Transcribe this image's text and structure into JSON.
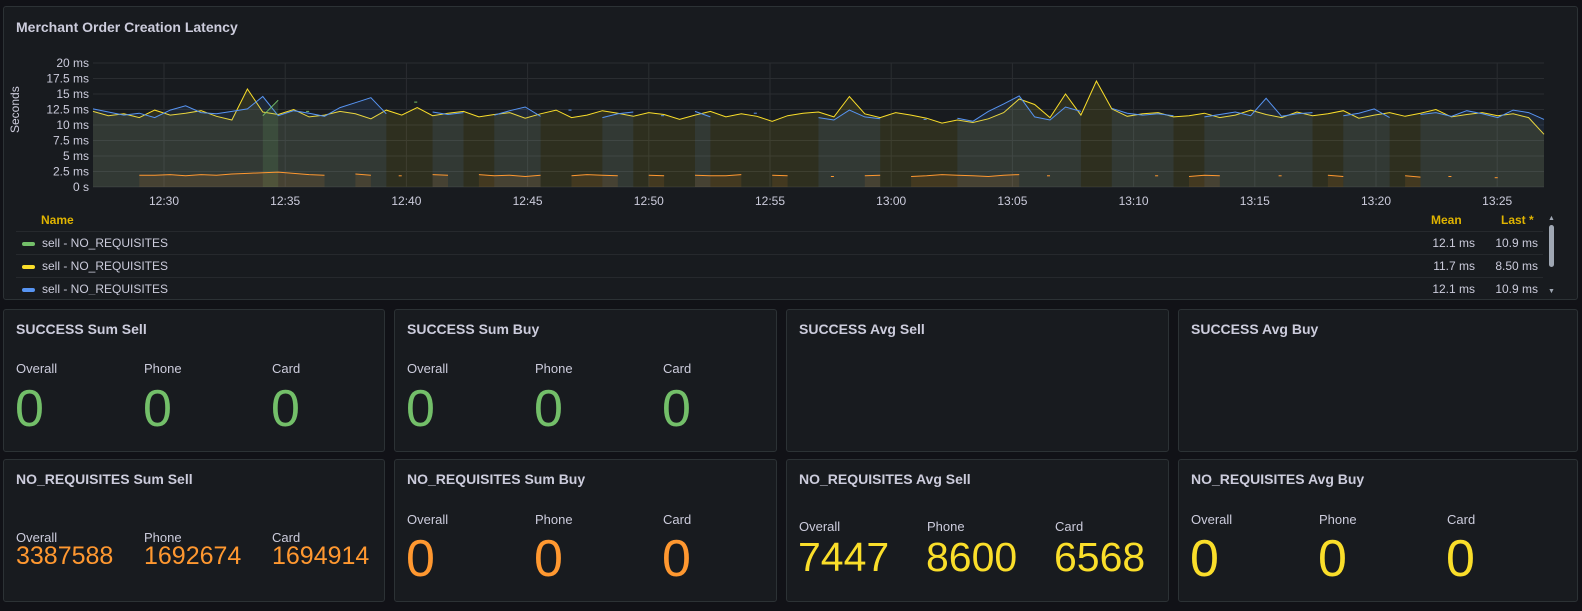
{
  "latency_panel": {
    "title": "Merchant Order Creation Latency",
    "y_axis_label": "Seconds",
    "legend_headers": {
      "name": "Name",
      "mean": "Mean",
      "last": "Last *"
    },
    "legend_rows": [
      {
        "name": "sell - NO_REQUISITES",
        "color": "#73bf69",
        "mean": "12.1 ms",
        "last": "10.9 ms"
      },
      {
        "name": "sell - NO_REQUISITES",
        "color": "#fade2a",
        "mean": "11.7 ms",
        "last": "8.50 ms"
      },
      {
        "name": "sell - NO_REQUISITES",
        "color": "#5794f2",
        "mean": "12.1 ms",
        "last": "10.9 ms"
      }
    ],
    "chart_data": {
      "type": "line",
      "ylabel": "Seconds",
      "ylim": [
        0,
        20
      ],
      "y_ticks": [
        "0 s",
        "2.5 ms",
        "5 ms",
        "7.5 ms",
        "10 ms",
        "12.5 ms",
        "15 ms",
        "17.5 ms",
        "20 ms"
      ],
      "x_ticks": [
        "12:30",
        "12:35",
        "12:40",
        "12:45",
        "12:50",
        "12:55",
        "13:00",
        "13:05",
        "13:10",
        "13:15",
        "13:20",
        "13:25"
      ],
      "grid": true,
      "series": [
        {
          "name": "sell - NO_REQUISITES",
          "color": "#fade2a",
          "values": [
            12.2,
            11.5,
            11.8,
            11.2,
            12.4,
            11.6,
            11.9,
            12.3,
            11.4,
            10.8,
            15.8,
            12.1,
            11.7,
            12.5,
            11.3,
            11.6,
            12.2,
            11.8,
            11.0,
            12.4,
            11.6,
            12.8,
            11.5,
            11.9,
            12.2,
            11.3,
            11.7,
            12.0,
            11.1,
            11.8,
            12.4,
            11.2,
            11.6,
            12.3,
            11.9,
            11.4,
            12.0,
            11.7,
            10.9,
            11.6,
            12.2,
            11.3,
            11.8,
            11.4,
            10.6,
            11.5,
            11.9,
            12.1,
            11.3,
            14.6,
            11.8,
            11.2,
            12.0,
            11.6,
            11.1,
            10.3,
            10.8,
            10.4,
            11.0,
            12.0,
            14.2,
            13.3,
            11.2,
            15.0,
            11.6,
            17.1,
            12.6,
            11.4,
            11.8,
            12.0,
            11.3,
            11.5,
            11.9,
            11.2,
            11.6,
            12.4,
            11.7,
            11.2,
            12.1,
            11.5,
            11.8,
            12.3,
            11.1,
            11.6,
            12.0,
            11.4,
            11.9,
            12.5,
            11.3,
            11.7,
            12.0,
            11.5,
            11.8,
            11.2,
            8.5
          ]
        },
        {
          "name": "sell - NO_REQUISITES",
          "color": "#5794f2",
          "values": [
            12.6,
            12.1,
            11.6,
            11.9,
            11.2,
            12.4,
            13.1,
            12.0,
            11.8,
            12.2,
            12.6,
            14.6,
            11.5,
            12.3,
            11.9,
            11.4,
            12.8,
            13.6,
            14.4,
            11.8,
            null,
            null,
            12.1,
            11.7,
            12.0,
            null,
            11.6,
            12.3,
            12.9,
            11.4,
            null,
            12.4,
            null,
            11.2,
            11.8,
            12.1,
            null,
            11.5,
            null,
            12.2,
            11.3,
            null,
            null,
            11.9,
            null,
            null,
            null,
            11.2,
            10.8,
            12.4,
            11.3,
            11.0,
            null,
            null,
            10.9,
            null,
            11.1,
            10.6,
            12.2,
            13.4,
            14.7,
            11.3,
            10.8,
            12.9,
            12.2,
            null,
            12.7,
            11.9,
            11.6,
            11.8,
            11.5,
            null,
            11.3,
            11.7,
            12.1,
            11.5,
            14.3,
            11.4,
            11.8,
            12.0,
            null,
            11.5,
            11.9,
            12.6,
            11.2,
            null,
            11.7,
            12.0,
            11.4,
            12.3,
            11.8,
            11.2,
            12.4,
            12.0,
            10.9
          ]
        },
        {
          "name": "sell - NO_REQUISITES",
          "color": "#73bf69",
          "values": [
            null,
            null,
            null,
            null,
            null,
            null,
            null,
            null,
            null,
            null,
            null,
            11.5,
            14.0,
            null,
            12.2,
            null,
            null,
            null,
            null,
            null,
            null,
            13.7,
            null,
            null,
            null,
            null,
            null,
            null,
            null,
            null,
            null,
            null,
            null,
            null,
            null,
            null,
            null,
            null,
            null,
            null,
            null,
            null,
            null,
            null,
            null,
            null,
            null,
            null,
            null,
            null,
            null,
            null,
            null,
            null,
            null,
            null,
            null,
            null,
            null,
            null,
            null,
            null,
            null,
            null,
            null,
            null,
            null,
            null,
            null,
            null,
            null,
            null,
            null,
            null,
            null,
            null,
            null,
            null,
            null,
            null,
            null,
            null,
            null,
            null,
            null,
            null,
            null,
            null,
            null,
            null,
            null,
            null,
            null,
            null,
            null
          ]
        },
        {
          "name": "orange",
          "color": "#ff9830",
          "values": [
            null,
            null,
            null,
            1.9,
            1.9,
            2.0,
            1.8,
            2.0,
            1.9,
            2.1,
            2.2,
            2.3,
            2.4,
            2.2,
            2.0,
            1.9,
            null,
            2.1,
            1.9,
            null,
            1.8,
            null,
            2.0,
            1.9,
            null,
            2.0,
            1.8,
            1.9,
            1.7,
            1.9,
            null,
            1.8,
            2.0,
            1.9,
            1.8,
            null,
            1.9,
            1.8,
            null,
            1.9,
            1.8,
            1.8,
            2.0,
            null,
            1.9,
            1.8,
            null,
            null,
            1.7,
            null,
            1.8,
            1.9,
            null,
            1.7,
            1.8,
            2.0,
            1.9,
            1.8,
            1.7,
            1.9,
            2.0,
            null,
            1.8,
            null,
            null,
            null,
            null,
            null,
            null,
            1.8,
            null,
            1.7,
            1.9,
            1.8,
            null,
            null,
            null,
            1.8,
            null,
            null,
            1.9,
            1.7,
            null,
            null,
            null,
            1.8,
            1.6,
            null,
            1.7,
            null,
            null,
            1.5,
            null,
            null,
            null
          ]
        }
      ]
    }
  },
  "stat_panels": [
    {
      "title": "SUCCESS Sum Sell",
      "color": "#73bf69",
      "items": [
        {
          "label": "Overall",
          "value": "0"
        },
        {
          "label": "Phone",
          "value": "0"
        },
        {
          "label": "Card",
          "value": "0"
        }
      ]
    },
    {
      "title": "SUCCESS Sum Buy",
      "color": "#73bf69",
      "items": [
        {
          "label": "Overall",
          "value": "0"
        },
        {
          "label": "Phone",
          "value": "0"
        },
        {
          "label": "Card",
          "value": "0"
        }
      ]
    },
    {
      "title": "SUCCESS Avg Sell",
      "color": "#73bf69",
      "items": []
    },
    {
      "title": "SUCCESS Avg Buy",
      "color": "#73bf69",
      "items": []
    },
    {
      "title": "NO_REQUISITES Sum Sell",
      "color": "#ff9830",
      "items": [
        {
          "label": "Overall",
          "value": "3387588"
        },
        {
          "label": "Phone",
          "value": "1692674"
        },
        {
          "label": "Card",
          "value": "1694914"
        }
      ]
    },
    {
      "title": "NO_REQUISITES Sum Buy",
      "color": "#ff9830",
      "items": [
        {
          "label": "Overall",
          "value": "0"
        },
        {
          "label": "Phone",
          "value": "0"
        },
        {
          "label": "Card",
          "value": "0"
        }
      ]
    },
    {
      "title": "NO_REQUISITES Avg Sell",
      "color": "#fade2a",
      "items": [
        {
          "label": "Overall",
          "value": "7447"
        },
        {
          "label": "Phone",
          "value": "8600"
        },
        {
          "label": "Card",
          "value": "6568"
        }
      ]
    },
    {
      "title": "NO_REQUISITES Avg Buy",
      "color": "#fade2a",
      "items": [
        {
          "label": "Overall",
          "value": "0"
        },
        {
          "label": "Phone",
          "value": "0"
        },
        {
          "label": "Card",
          "value": "0"
        }
      ]
    }
  ]
}
